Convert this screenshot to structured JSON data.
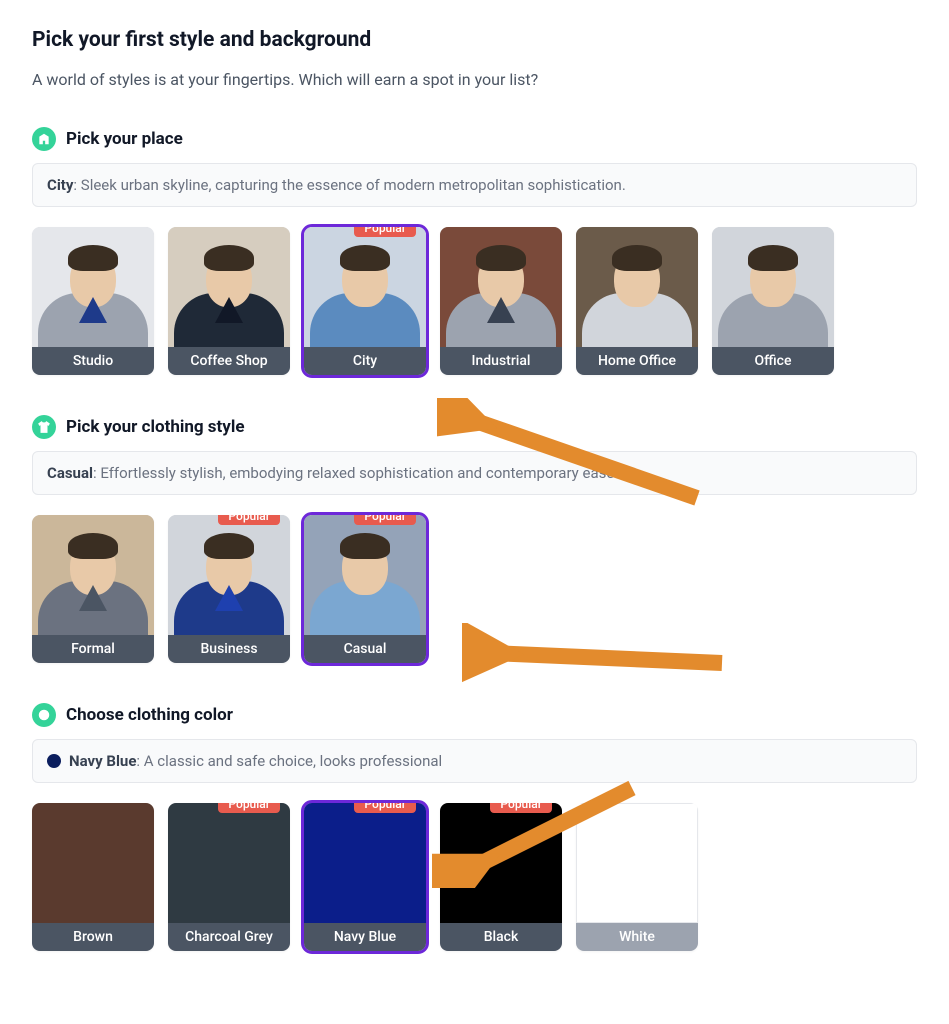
{
  "header": {
    "title": "Pick your first style and background",
    "subtitle": "A world of styles is at your fingertips. Which will earn a spot in your list?"
  },
  "popular_label": "Popular",
  "sections": {
    "place": {
      "icon_color": "#34d399",
      "title": "Pick your place",
      "selected_name": "City",
      "selected_desc": "Sleek urban skyline, capturing the essence of modern metropolitan sophistication.",
      "options": [
        {
          "label": "Studio",
          "popular": false,
          "selected": false,
          "bg": "#e5e7eb",
          "body": "#9ca3af",
          "tie": "#1e3a8a"
        },
        {
          "label": "Coffee Shop",
          "popular": false,
          "selected": false,
          "bg": "#d6cdbf",
          "body": "#1f2937",
          "tie": "#111827"
        },
        {
          "label": "City",
          "popular": true,
          "selected": true,
          "bg": "#cbd5e1",
          "body": "#5b8bbf",
          "tie": ""
        },
        {
          "label": "Industrial",
          "popular": false,
          "selected": false,
          "bg": "#7a4a3a",
          "body": "#9ca3af",
          "tie": "#374151"
        },
        {
          "label": "Home Office",
          "popular": false,
          "selected": false,
          "bg": "#6b5b4a",
          "body": "#d1d5db",
          "tie": ""
        },
        {
          "label": "Office",
          "popular": false,
          "selected": false,
          "bg": "#d1d5db",
          "body": "#9ca3af",
          "tie": ""
        }
      ]
    },
    "clothing": {
      "icon_color": "#34d399",
      "title": "Pick your clothing style",
      "selected_name": "Casual",
      "selected_desc": "Effortlessly stylish, embodying relaxed sophistication and contemporary ease.",
      "options": [
        {
          "label": "Formal",
          "popular": false,
          "selected": false,
          "bg": "#cbb79a",
          "body": "#6b7280",
          "tie": "#4b5563"
        },
        {
          "label": "Business",
          "popular": true,
          "selected": false,
          "bg": "#d1d5db",
          "body": "#1e3a8a",
          "tie": "#1e40af"
        },
        {
          "label": "Casual",
          "popular": true,
          "selected": true,
          "bg": "#94a3b8",
          "body": "#7ba7d1",
          "tie": ""
        }
      ]
    },
    "color": {
      "icon_color": "#34d399",
      "title": "Choose clothing color",
      "selected_name": "Navy Blue",
      "selected_desc": "A classic and safe choice, looks professional",
      "selected_swatch": "#0b1e5e",
      "options": [
        {
          "label": "Brown",
          "popular": false,
          "selected": false,
          "color": "#5a3a2e"
        },
        {
          "label": "Charcoal Grey",
          "popular": true,
          "selected": false,
          "color": "#2f3a42"
        },
        {
          "label": "Navy Blue",
          "popular": true,
          "selected": true,
          "color": "#0b1e8a"
        },
        {
          "label": "Black",
          "popular": true,
          "selected": false,
          "color": "#000000"
        },
        {
          "label": "White",
          "popular": false,
          "selected": false,
          "color": "#ffffff"
        }
      ]
    }
  }
}
